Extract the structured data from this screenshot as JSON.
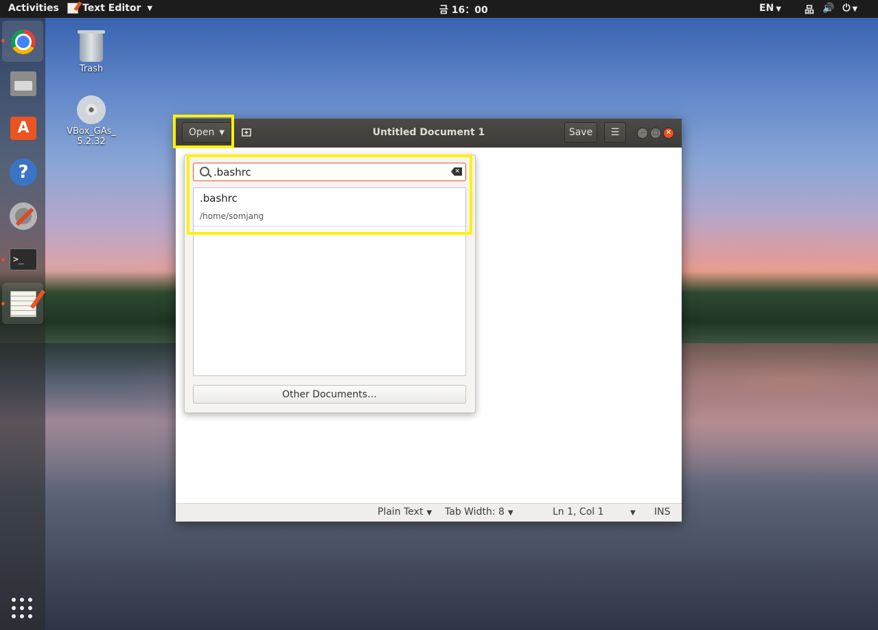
{
  "topbar": {
    "activities": "Activities",
    "app_name": "Text Editor",
    "clock": "금 16：00",
    "language": "EN"
  },
  "desktop": {
    "trash_label": "Trash",
    "cd_label_line1": "VBox_GAs_",
    "cd_label_line2": "5.2.32"
  },
  "window": {
    "title": "Untitled Document 1",
    "open_label": "Open",
    "save_label": "Save"
  },
  "popover": {
    "search_value": ".bashrc",
    "results": [
      {
        "name": ".bashrc",
        "path": "/home/somjang"
      }
    ],
    "other_documents_label": "Other Documents…"
  },
  "statusbar": {
    "language": "Plain Text",
    "tab_width": "Tab Width: 8",
    "position": "Ln 1, Col 1",
    "mode": "INS"
  },
  "colors": {
    "accent": "#e95420",
    "highlight": "#fff200",
    "topbar": "#1c1c1c",
    "headerbar": "#3c3b37"
  }
}
